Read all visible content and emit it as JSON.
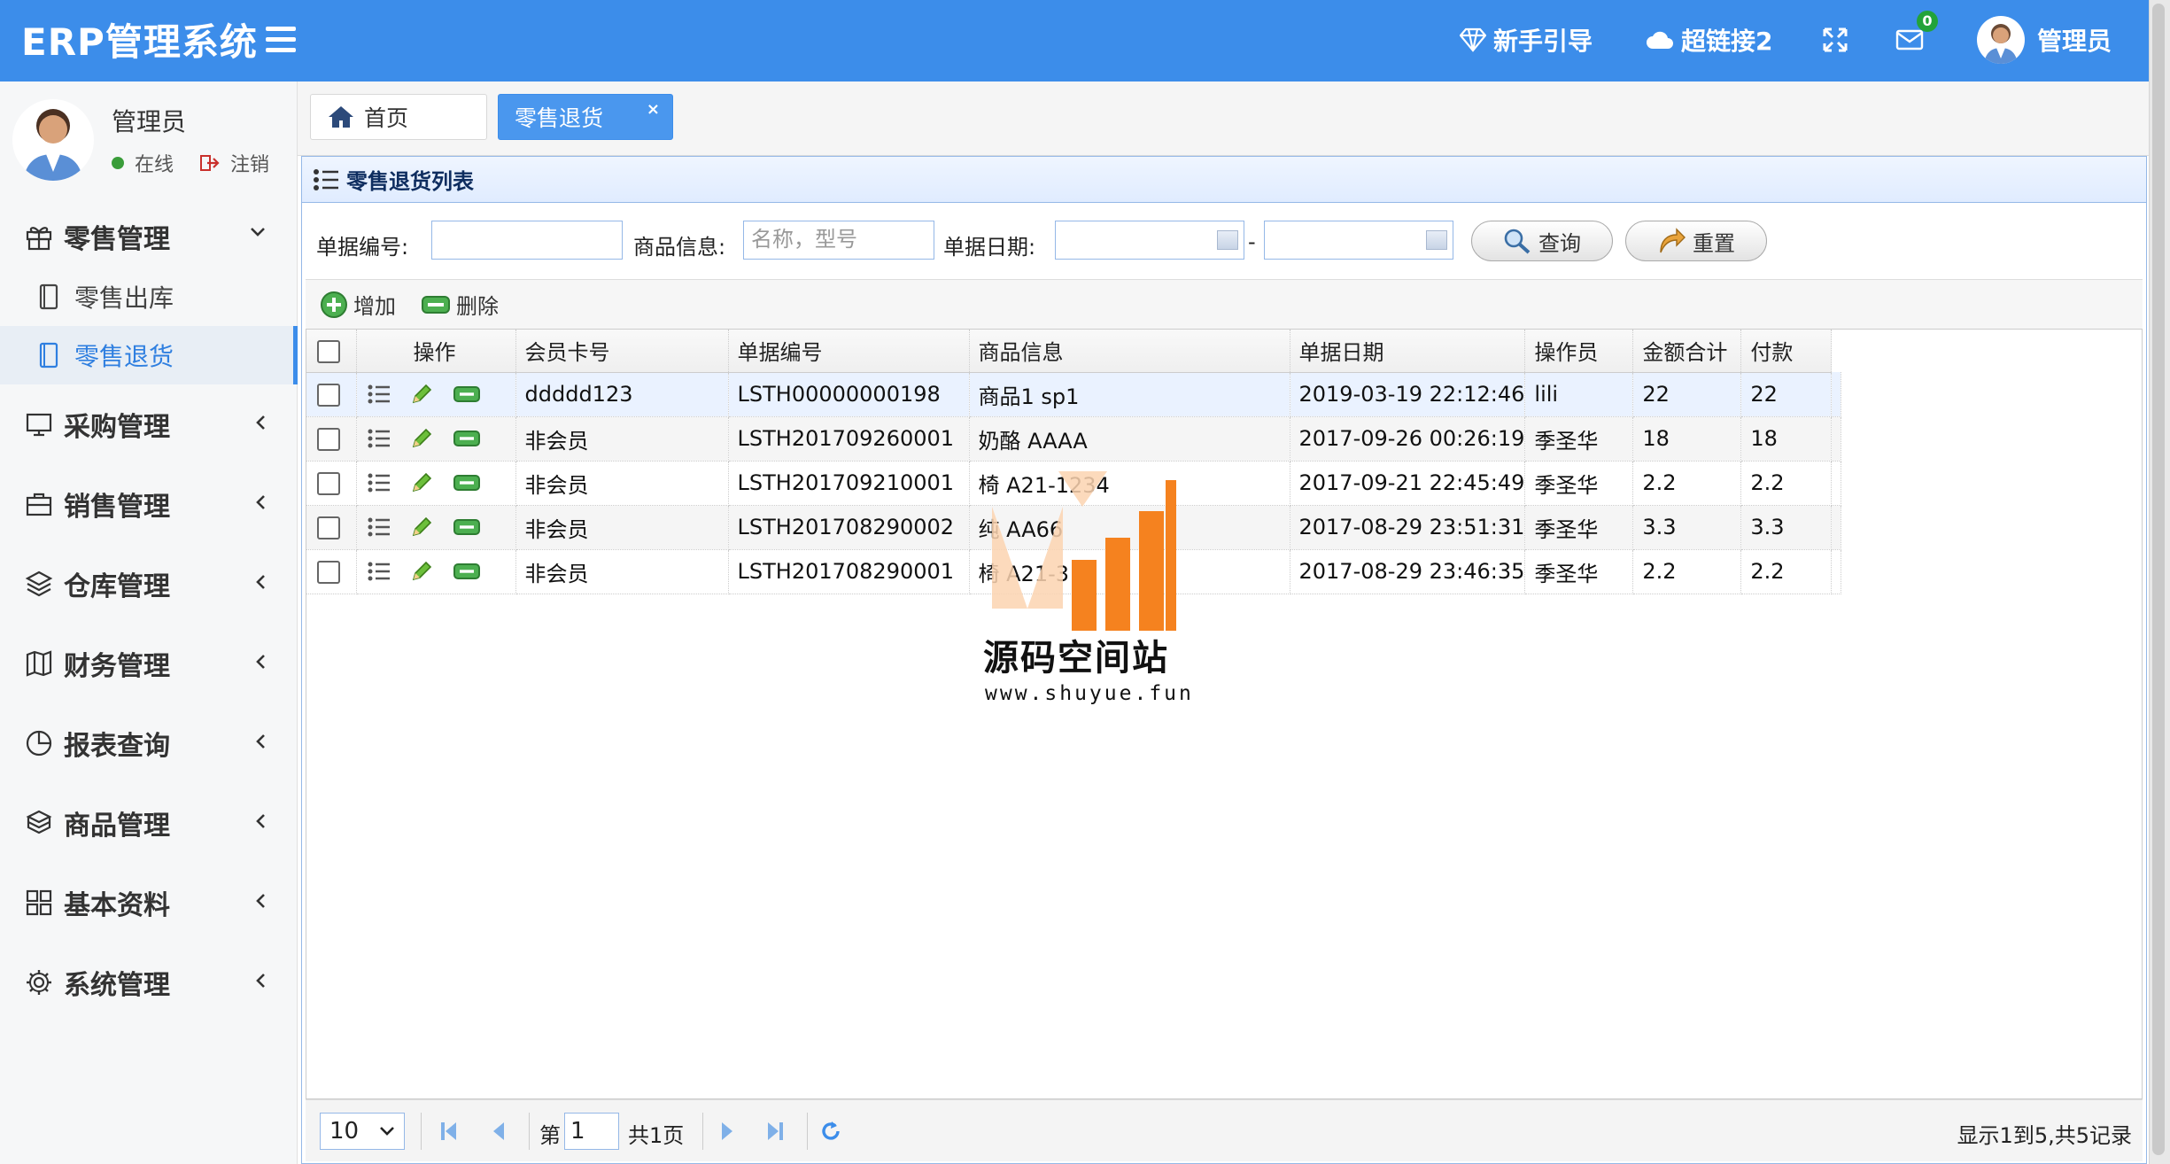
{
  "header": {
    "brand": "ERP管理系统",
    "guide_label": "新手引导",
    "link_label": "超链接2",
    "mail_badge": "0",
    "user_name": "管理员"
  },
  "sidebar": {
    "user_name": "管理员",
    "status_online": "在线",
    "logout_label": "注销",
    "groups": [
      {
        "label": "零售管理",
        "icon": "gift-icon",
        "expanded": true,
        "items": [
          {
            "label": "零售出库"
          },
          {
            "label": "零售退货",
            "active": true
          }
        ]
      },
      {
        "label": "采购管理",
        "icon": "monitor-icon"
      },
      {
        "label": "销售管理",
        "icon": "briefcase-icon"
      },
      {
        "label": "仓库管理",
        "icon": "layers-icon"
      },
      {
        "label": "财务管理",
        "icon": "map-icon"
      },
      {
        "label": "报表查询",
        "icon": "clock-icon"
      },
      {
        "label": "商品管理",
        "icon": "box-icon"
      },
      {
        "label": "基本资料",
        "icon": "grid-icon"
      },
      {
        "label": "系统管理",
        "icon": "gear-icon"
      }
    ]
  },
  "tabs": [
    {
      "label": "首页"
    },
    {
      "label": "零售退货",
      "close": "×"
    }
  ],
  "panel": {
    "title": "零售退货列表"
  },
  "search": {
    "doc_no_label": "单据编号:",
    "goods_label": "商品信息:",
    "goods_placeholder": "名称，型号",
    "date_label": "单据日期:",
    "date_sep": "-",
    "query_label": "查询",
    "reset_label": "重置"
  },
  "toolbar": {
    "add_label": "增加",
    "delete_label": "删除"
  },
  "table": {
    "headers": [
      "操作",
      "会员卡号",
      "单据编号",
      "商品信息",
      "单据日期",
      "操作员",
      "金额合计",
      "付款"
    ],
    "rows": [
      [
        "ddddd123",
        "LSTH00000000198",
        "商品1 sp1",
        "2019-03-19 22:12:46",
        "lili",
        "22",
        "22"
      ],
      [
        "非会员",
        "LSTH201709260001",
        "奶酪 AAAA",
        "2017-09-26 00:26:19",
        "季圣华",
        "18",
        "18"
      ],
      [
        "非会员",
        "LSTH201709210001",
        "椅 A21-1234",
        "2017-09-21 22:45:49",
        "季圣华",
        "2.2",
        "2.2"
      ],
      [
        "非会员",
        "LSTH201708290002",
        "纯 AA66",
        "2017-08-29 23:51:31",
        "季圣华",
        "3.3",
        "3.3"
      ],
      [
        "非会员",
        "LSTH201708290001",
        "椅 A21-3",
        "2017-08-29 23:46:35",
        "季圣华",
        "2.2",
        "2.2"
      ]
    ]
  },
  "pager": {
    "page_size": "10",
    "page_prefix": "第",
    "page_value": "1",
    "page_total": "共1页",
    "info": "显示1到5,共5记录"
  },
  "watermark": {
    "title": "源码空间站",
    "url": "www.shuyue.fun"
  },
  "colors": {
    "accent": "#3c8dea",
    "panel_border": "#95b8e7",
    "watermark_orange": "#f5821f"
  }
}
